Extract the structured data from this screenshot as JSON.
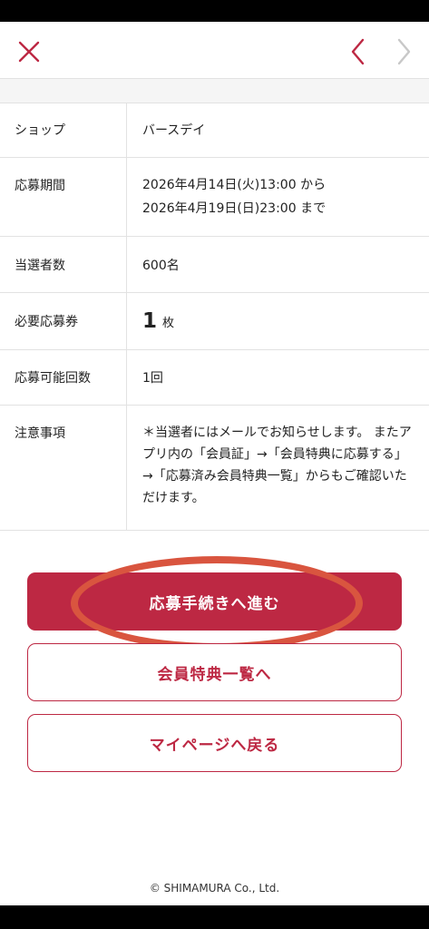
{
  "header": {
    "close_icon": "close-icon",
    "prev_icon": "chevron-left-icon",
    "next_icon": "chevron-right-icon",
    "accent_color": "#bd2843",
    "next_disabled_color": "#c8c8c8"
  },
  "details": {
    "shop": {
      "label": "ショップ",
      "value": "バースデイ"
    },
    "period": {
      "label": "応募期間",
      "line1": "2026年4月14日(火)13:00 から",
      "line2": "2026年4月19日(日)23:00 まで"
    },
    "winners": {
      "label": "当選者数",
      "value": "600名"
    },
    "tickets": {
      "label": "必要応募券",
      "number": "1",
      "unit": "枚"
    },
    "count": {
      "label": "応募可能回数",
      "value": "1回"
    },
    "notes": {
      "label": "注意事項",
      "value": "＊当選者にはメールでお知らせします。 またアプリ内の「会員証」→「会員特典に応募する」→「応募済み会員特典一覧」からもご確認いただけます。"
    }
  },
  "buttons": {
    "apply": "応募手続きへ進む",
    "member_list": "会員特典一覧へ",
    "mypage": "マイページへ戻る"
  },
  "highlight_color": "#d9553f",
  "footer": {
    "copyright": "© SHIMAMURA Co., Ltd."
  }
}
